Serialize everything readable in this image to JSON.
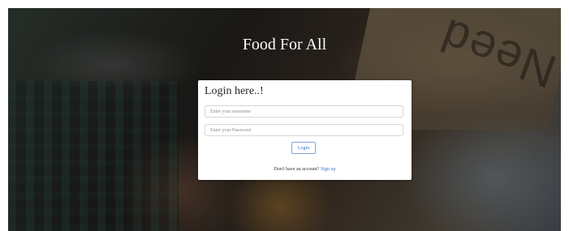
{
  "brand": {
    "title": "Food For All"
  },
  "background": {
    "sign_text": "Need"
  },
  "login": {
    "title": "Login here..!",
    "username_placeholder": "Enter your username",
    "password_placeholder": "Enter your Password",
    "login_button": "Login",
    "signup_prompt": "Don't have an account?",
    "signup_link": "Sign up"
  },
  "colors": {
    "link": "#3a78c2",
    "card": "#ffffff",
    "overlay": "rgba(0,0,0,0.38)"
  }
}
